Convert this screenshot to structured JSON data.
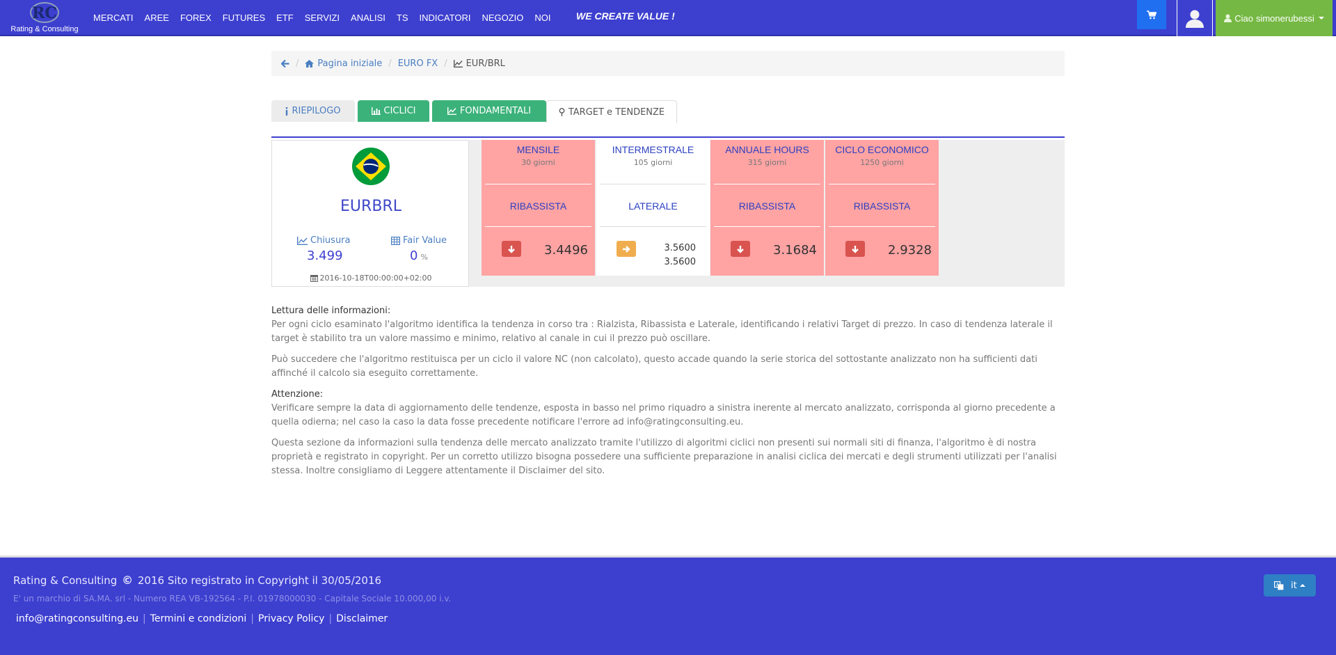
{
  "brand": {
    "text": "Rating & Consulting"
  },
  "nav": {
    "items": [
      "MERCATI",
      "AREE",
      "FOREX",
      "FUTURES",
      "ETF",
      "SERVIZI",
      "ANALISI",
      "TS",
      "INDICATORI",
      "NEGOZIO",
      "NOI"
    ],
    "slogan": "WE CREATE VALUE !",
    "greeting": "Ciao",
    "username": "simonerubessi"
  },
  "breadcrumb": {
    "home": "Pagina iniziale",
    "parent": "EURO FX",
    "current": "EUR/BRL"
  },
  "tabs": {
    "riepilogo": "RIEPILOGO",
    "ciclici": "CICLICI",
    "fondamentali": "FONDAMENTALI",
    "target": "TARGET e TENDENZE"
  },
  "summary": {
    "symbol": "EURBRL",
    "close_label": "Chiusura",
    "close_value": "3.499",
    "fair_label": "Fair Value",
    "fair_value": "0",
    "fair_unit": "%",
    "date": "2016-10-18T00:00:00+02:00",
    "cycles": [
      {
        "name": "MENSILE",
        "days": "30 giorni",
        "trend": "RIBASSISTA",
        "target": "3.4496",
        "arrow": "down"
      },
      {
        "name": "INTERMESTRALE",
        "days": "105 giorni",
        "trend": "LATERALE",
        "target_high": "3.5600",
        "target_low": "3.5600",
        "arrow": "right"
      },
      {
        "name": "ANNUALE HOURS",
        "days": "315 giorni",
        "trend": "RIBASSISTA",
        "target": "3.1684",
        "arrow": "down"
      },
      {
        "name": "CICLO ECONOMICO",
        "days": "1250 giorni",
        "trend": "RIBASSISTA",
        "target": "2.9328",
        "arrow": "down"
      }
    ]
  },
  "content": {
    "lettura_title": "Lettura delle informazioni:",
    "p1": "Per ogni ciclo esaminato l'algoritmo identifica la tendenza in corso tra : Rialzista, Ribassista e Laterale, identificando i relativi Target di prezzo. In caso di tendenza laterale il target è stabilito tra un valore massimo e minimo, relativo al canale in cui il prezzo può oscillare.",
    "p2": "Può succedere che l'algoritmo restituisca per un ciclo il valore NC (non calcolato), questo accade quando la serie storica del sottostante analizzato non ha sufficienti dati affinché il calcolo sia eseguito correttamente.",
    "attenzione_title": "Attenzione:",
    "p3": "Verificare sempre la data di aggiornamento delle tendenze, esposta in basso nel primo riquadro a sinistra inerente al mercato analizzato, corrisponda al giorno precedente a quella odierna; nel caso la caso la data fosse precedente notificare l'errore ad info@ratingconsulting.eu.",
    "p4": "Questa sezione da informazioni sulla tendenza delle mercato analizzato tramite l'utilizzo di algoritmi ciclici non presenti sui normali siti di finanza, l'algoritmo è di nostra proprietà e registrato in copyright. Per un corretto utilizzo bisogna possedere una sufficiente preparazione in analisi ciclica dei mercati e degli strumenti utilizzati per l'analisi stessa. Inoltre consigliamo di Leggere attentamente il Disclaimer del sito."
  },
  "footer": {
    "company": "Rating & Consulting",
    "copyright_symbol": "©",
    "copyright_text": "2016 Sito registrato in Copyright il 30/05/2016",
    "legal": "E' un marchio di SA.MA. srl - Numero REA VB-192564 - P.I. 01978000030 - Capitale Sociale 10.000,00 i.v.",
    "links": [
      "info@ratingconsulting.eu",
      "Termini e condizioni",
      "Privacy Policy",
      "Disclaimer"
    ],
    "lang": "it"
  },
  "colors": {
    "primary": "#3d3fcf",
    "bearish": "#ffa3a3",
    "tab_green": "#3bb27a",
    "user_green": "#75b843",
    "arrow_down": "#d9534f",
    "arrow_right": "#f0ad4e"
  }
}
